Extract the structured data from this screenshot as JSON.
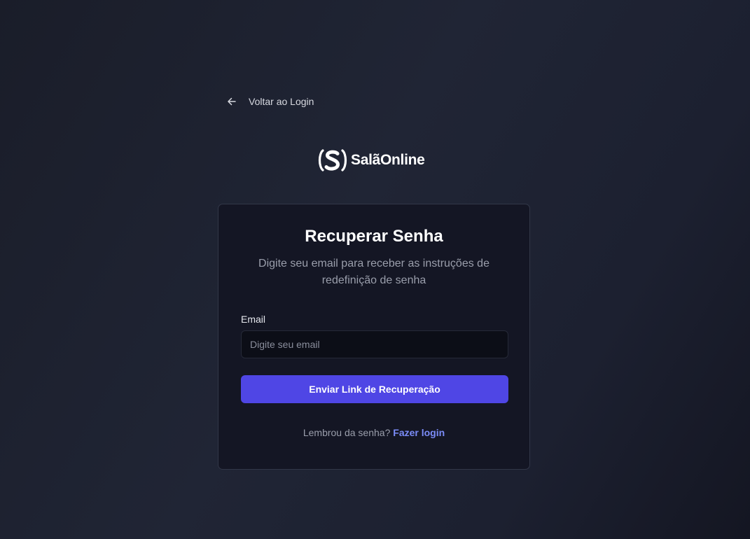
{
  "back_link": {
    "label": "Voltar ao Login",
    "icon": "arrow-left-icon"
  },
  "logo": {
    "icon": "salaonline-s-logo",
    "text": "SalãOnline"
  },
  "card": {
    "title": "Recuperar Senha",
    "subtitle": "Digite seu email para receber as instruções de redefinição de senha",
    "email_label": "Email",
    "email_placeholder": "Digite seu email",
    "email_value": "",
    "submit_label": "Enviar Link de Recuperação",
    "footer_text": "Lembrou da senha?",
    "footer_link": "Fazer login"
  },
  "colors": {
    "accent": "#4f46e5",
    "link": "#7b8cf8",
    "card_bg": "#141624",
    "page_bg": "#1e2231"
  }
}
